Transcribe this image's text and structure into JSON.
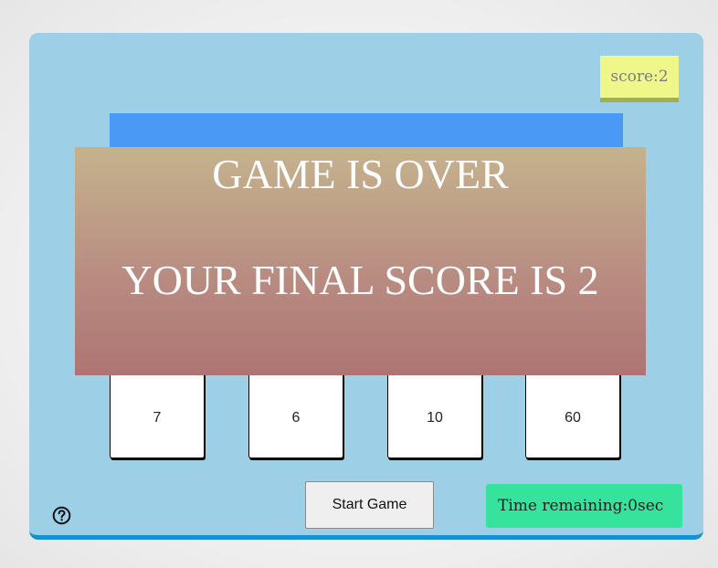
{
  "game": {
    "score_label": "score:2",
    "gameover_title": "GAME IS OVER",
    "final_score_message": "YOUR FINAL SCORE IS 2",
    "choices": [
      "7",
      "6",
      "10",
      "60"
    ],
    "start_button_label": "Start Game",
    "time_remaining_label": "Time remaining:0sec"
  },
  "icons": {
    "help": "help-circle-icon"
  },
  "colors": {
    "container_bg": "#9dcfe7",
    "container_border": "#1591d1",
    "score_bg": "#f0f78a",
    "question_bg": "#4a9af5",
    "timer_bg": "#35e39c",
    "gameover_top": "#c5b38d",
    "gameover_bottom": "#ae7473"
  }
}
